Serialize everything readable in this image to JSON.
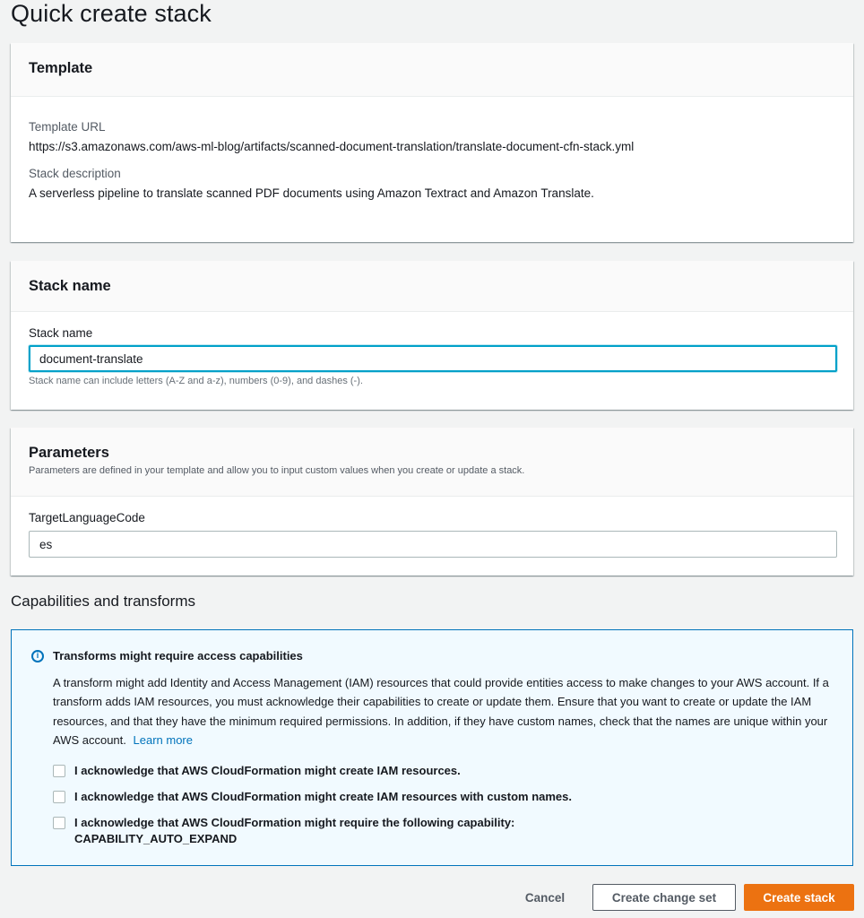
{
  "page": {
    "title": "Quick create stack"
  },
  "template_panel": {
    "heading": "Template",
    "url_label": "Template URL",
    "url_value": "https://s3.amazonaws.com/aws-ml-blog/artifacts/scanned-document-translation/translate-document-cfn-stack.yml",
    "description_label": "Stack description",
    "description_value": "A serverless pipeline to translate scanned PDF documents using Amazon Textract and Amazon Translate."
  },
  "stack_name_panel": {
    "heading": "Stack name",
    "field_label": "Stack name",
    "field_value": "document-translate",
    "constraint_text": "Stack name can include letters (A-Z and a-z), numbers (0-9), and dashes (-)."
  },
  "parameters_panel": {
    "heading": "Parameters",
    "description": "Parameters are defined in your template and allow you to input custom values when you create or update a stack.",
    "params": [
      {
        "label": "TargetLanguageCode",
        "value": "es"
      }
    ]
  },
  "capabilities": {
    "heading": "Capabilities and transforms",
    "info": {
      "icon": "info-icon",
      "title": "Transforms might require access capabilities",
      "body": "A transform might add Identity and Access Management (IAM) resources that could provide entities access to make changes to your AWS account. If a transform adds IAM resources, you must acknowledge their capabilities to create or update them. Ensure that you want to create or update the IAM resources, and that they have the minimum required permissions. In addition, if they have custom names, check that the names are unique within your AWS account.",
      "link_text": "Learn more"
    },
    "acknowledgements": [
      {
        "label": "I acknowledge that AWS CloudFormation might create IAM resources.",
        "checked": false
      },
      {
        "label": "I acknowledge that AWS CloudFormation might create IAM resources with custom names.",
        "checked": false
      },
      {
        "label": "I acknowledge that AWS CloudFormation might require the following capability:",
        "label_line2": "CAPABILITY_AUTO_EXPAND",
        "checked": false
      }
    ]
  },
  "actions": {
    "cancel_label": "Cancel",
    "change_set_label": "Create change set",
    "create_label": "Create stack"
  },
  "colors": {
    "primary_button": "#ec7211",
    "focus_border": "#00a1c9",
    "info_border": "#0073bb",
    "info_background": "#f1faff",
    "link": "#0073bb"
  }
}
